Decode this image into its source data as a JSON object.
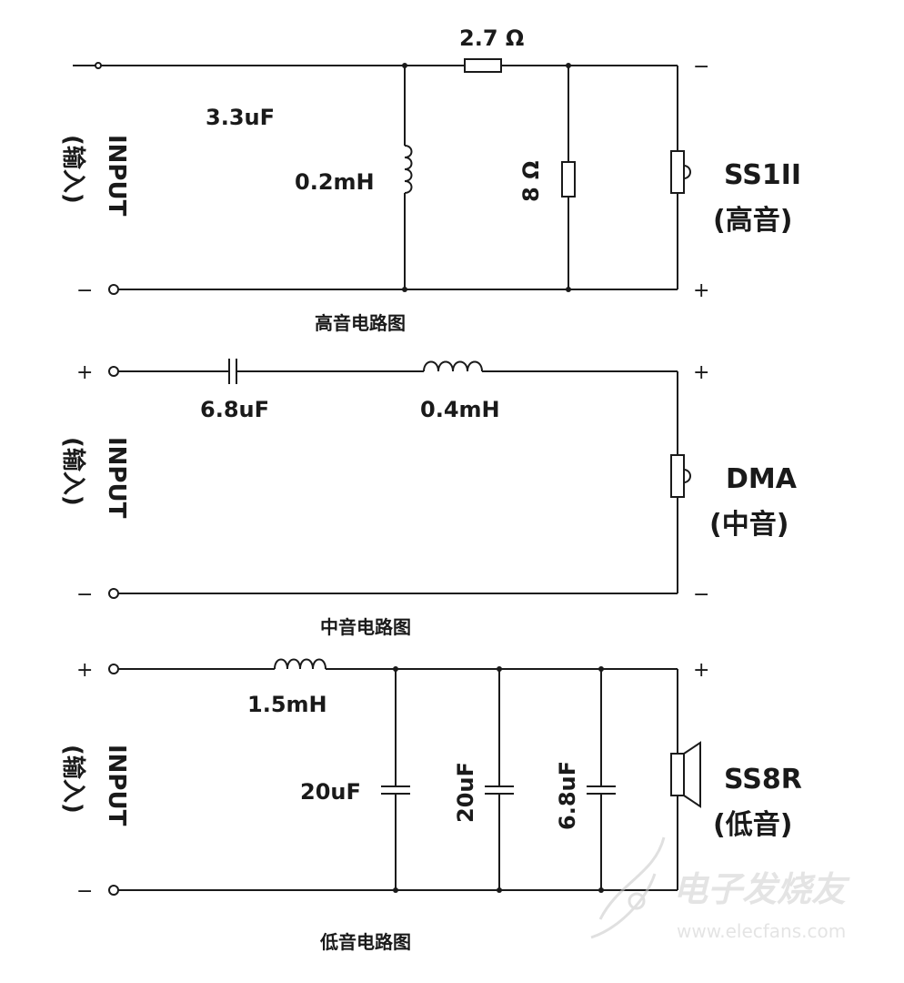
{
  "input_label": "INPUT",
  "input_label_cn": "(输入)",
  "polarity": {
    "plus": "+",
    "minus": "−"
  },
  "tweeter": {
    "caption": "高音电路图",
    "capacitor": "3.3uF",
    "series_resistor": "2.7 Ω",
    "inductor": "0.2mH",
    "shunt_resistor": "8 Ω",
    "speaker_name": "SS1II",
    "speaker_type": "(高音)"
  },
  "midrange": {
    "caption": "中音电路图",
    "capacitor": "6.8uF",
    "inductor": "0.4mH",
    "speaker_name": "DMA",
    "speaker_type": "(中音)"
  },
  "woofer": {
    "caption": "低音电路图",
    "inductor": "1.5mH",
    "capacitor_1": "20uF",
    "capacitor_2": "20uF",
    "capacitor_3": "6.8uF",
    "speaker_name": "SS8R",
    "speaker_type": "(低音)"
  },
  "watermark": {
    "text": "电子发烧友",
    "url": "www.elecfans.com"
  }
}
